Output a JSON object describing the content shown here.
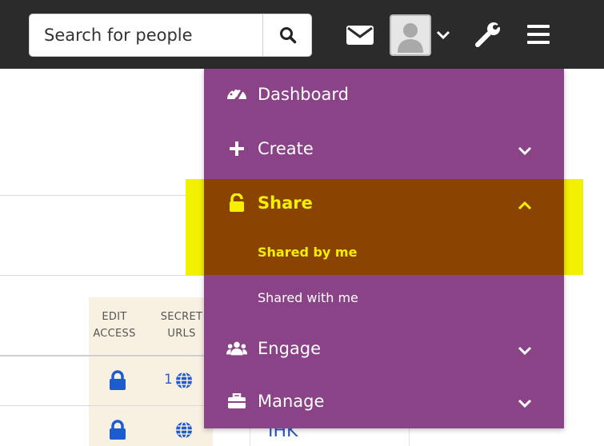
{
  "topbar": {
    "search_placeholder": "Search for people",
    "icons": [
      "search-icon",
      "mail-icon",
      "avatar",
      "chevron-down-icon",
      "wrench-icon",
      "hamburger-menu-icon"
    ]
  },
  "table": {
    "headers": [
      {
        "line1": "EDIT",
        "line2": "ACCESS"
      },
      {
        "line1": "SECRET",
        "line2": "URLS"
      }
    ],
    "rows": [
      {
        "edit_access_icon": "lock-icon",
        "secret_urls_count": "1",
        "secret_urls_icon": "globe-icon"
      },
      {
        "edit_access_icon": "lock-icon",
        "secret_urls_count": "",
        "secret_urls_icon": "globe-icon"
      }
    ],
    "partial_link_text": "IHK"
  },
  "menu": {
    "items": [
      {
        "label": "Dashboard",
        "icon": "dashboard-icon"
      },
      {
        "label": "Create",
        "icon": "plus-icon",
        "chevron": "chevron-down-icon"
      },
      {
        "label": "Share",
        "icon": "unlock-icon",
        "chevron": "chevron-up-icon",
        "expanded": true,
        "children": [
          {
            "label": "Shared by me",
            "active": true
          },
          {
            "label": "Shared with me"
          }
        ]
      },
      {
        "label": "Engage",
        "icon": "users-icon",
        "chevron": "chevron-down-icon"
      },
      {
        "label": "Manage",
        "icon": "briefcase-icon",
        "chevron": "chevron-down-icon"
      }
    ]
  },
  "colors": {
    "topbar": "#2b2b2b",
    "menu_bg": "#8a4387",
    "active_section_bg": "#8a4300",
    "active_text": "#f5f000",
    "highlight": "#f0f000",
    "link": "#2563c9"
  }
}
